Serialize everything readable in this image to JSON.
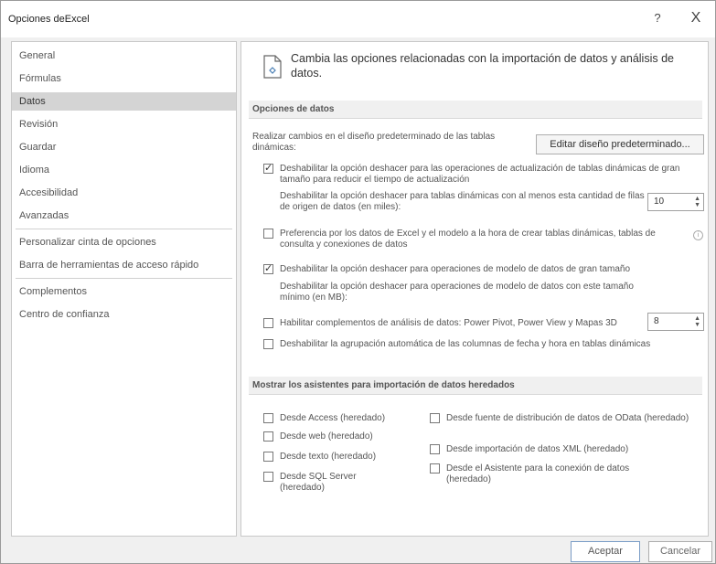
{
  "window": {
    "title": "Opciones deExcel",
    "help_label": "?",
    "close_label": "X"
  },
  "sidebar": {
    "items": [
      {
        "label": "General"
      },
      {
        "label": "Fórmulas"
      },
      {
        "label": "Datos",
        "selected": true
      },
      {
        "label": "Revisión"
      },
      {
        "label": "Guardar"
      },
      {
        "label": "Idioma"
      },
      {
        "label": "Accesibilidad"
      },
      {
        "label": "Avanzadas"
      },
      {
        "label": "Personalizar cinta de opciones"
      },
      {
        "label": "Barra de herramientas de acceso rápido"
      },
      {
        "label": "Complementos"
      },
      {
        "label": "Centro de confianza"
      }
    ]
  },
  "header": {
    "text": "Cambia las opciones relacionadas con la importación de datos y análisis de datos.",
    "icon": "data-options-icon"
  },
  "opciones": {
    "title": "Opciones de datos",
    "pivot_label": "Realizar cambios en el diseño predeterminado de las tablas dinámicas:",
    "pivot_button": "Editar diseño predeterminado...",
    "cb1_label": "Deshabilitar la opción deshacer para las operaciones de actualización de tablas dinámicas de gran tamaño para reducir el tiempo de actualización",
    "rows_label": "Deshabilitar la opción deshacer para tablas dinámicas con al menos esta cantidad de filas de origen de datos (en miles):",
    "rows_value": "10",
    "cb2_label": "Preferencia por los datos de Excel y el modelo a la hora de crear tablas dinámicas, tablas de consulta y conexiones de datos",
    "cb3_label": "Deshabilitar la opción deshacer para operaciones de modelo de datos de gran tamaño",
    "model_label": "Deshabilitar la opción deshacer para operaciones de modelo de datos con este tamaño mínimo (en MB):",
    "model_value": "8",
    "cb4_label": "Habilitar complementos de análisis de datos: Power Pivot, Power View y Mapas 3D",
    "cb5_label": "Deshabilitar la agrupación automática de las columnas de fecha y hora en tablas dinámicas",
    "cb1_checked": true,
    "cb2_checked": false,
    "cb3_checked": true,
    "cb4_checked": false,
    "cb5_checked": false
  },
  "legacy": {
    "title": "Mostrar los asistentes para importación de datos heredados",
    "left": [
      {
        "label": "Desde Access (heredado)"
      },
      {
        "label": "Desde web (heredado)"
      },
      {
        "label": "Desde texto (heredado)"
      },
      {
        "label": "Desde SQL Server (heredado)"
      }
    ],
    "right": [
      {
        "label": "Desde fuente de distribución de datos de OData (heredado)"
      },
      {
        "label": "Desde importación de datos XML (heredado)"
      },
      {
        "label": "Desde el Asistente para la conexión de datos (heredado)"
      }
    ]
  },
  "footer": {
    "ok": "Aceptar",
    "cancel": "Cancelar"
  }
}
